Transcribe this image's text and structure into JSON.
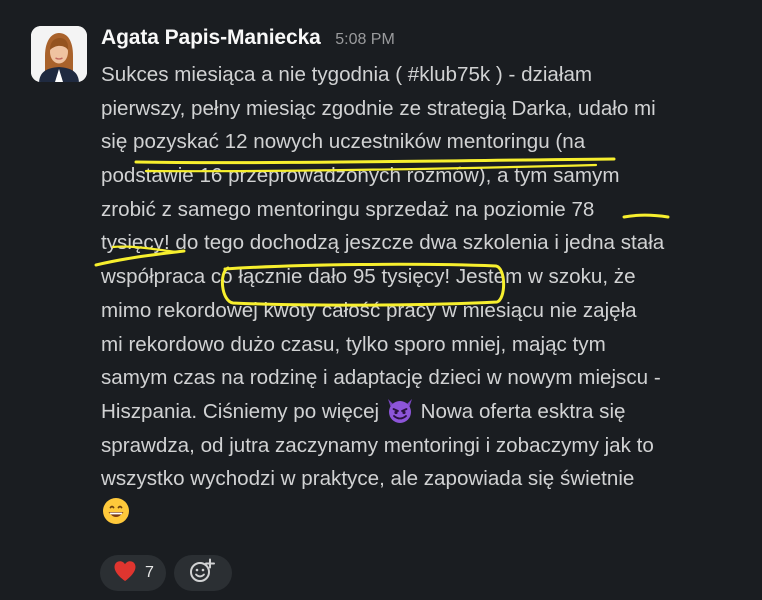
{
  "message": {
    "author": "Agata Papis-Maniecka",
    "time": "5:08 PM",
    "lines": [
      "Sukces miesiąca a nie tygodnia ( #klub75k ) - działam",
      "pierwszy, pełny miesiąc zgodnie ze strategią Darka, udało mi",
      "się pozyskać 12 nowych uczestników mentoringu (na",
      "podstawie 16 przeprowadzonych rozmów), a tym samym",
      "zrobić z samego mentoringu sprzedaż na poziomie 78",
      "tysięcy! do tego dochodzą jeszcze dwa szkolenia i jedna stała",
      "współpraca co łącznie dało 95 tysięcy! Jestem w szoku, że",
      "mimo rekordowej kwoty całość pracy w miesiącu nie zajęła",
      "mi rekordowo dużo czasu, tylko sporo mniej, mając tym",
      "samym czas na rodzinę i adaptację dzieci w nowym miejscu -",
      "Hiszpania. Ciśniemy po więcej",
      "Nowa oferta esktra się",
      "sprawdza, od jutra zaczynamy mentoringi i zobaczymy jak to",
      "wszystko wychodzi w praktyce, ale zapowiada się świetnie"
    ]
  },
  "reactions": [
    {
      "emoji": "red-heart",
      "count": "7"
    },
    {
      "emoji": "add-reaction-icon",
      "count": ""
    }
  ],
  "colors": {
    "background": "#1a1d21",
    "text": "#d1d2d3",
    "highlight": "#f7ef2e",
    "reaction_bg": "#2b2f33"
  }
}
